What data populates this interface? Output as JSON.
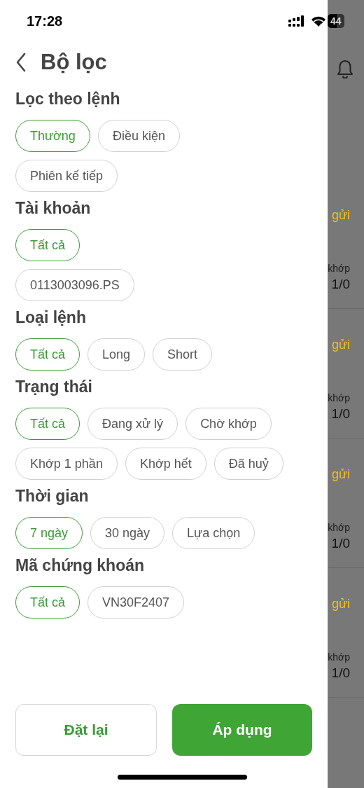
{
  "status_bar": {
    "time": "17:28",
    "battery": "44"
  },
  "header": {
    "title": "Bộ lọc"
  },
  "sections": [
    {
      "title": "Lọc theo lệnh",
      "rows": [
        [
          {
            "label": "Thường",
            "selected": true
          },
          {
            "label": "Điều kiện",
            "selected": false
          }
        ],
        [
          {
            "label": "Phiên kế tiếp",
            "selected": false
          }
        ]
      ]
    },
    {
      "title": "Tài khoản",
      "rows": [
        [
          {
            "label": "Tất cả",
            "selected": true
          }
        ],
        [
          {
            "label": "0113003096.PS",
            "selected": false
          }
        ]
      ]
    },
    {
      "title": "Loại lệnh",
      "rows": [
        [
          {
            "label": "Tất cả",
            "selected": true
          },
          {
            "label": "Long",
            "selected": false
          },
          {
            "label": "Short",
            "selected": false
          }
        ]
      ]
    },
    {
      "title": "Trạng thái",
      "rows": [
        [
          {
            "label": "Tất cả",
            "selected": true
          },
          {
            "label": "Đang xử lý",
            "selected": false
          },
          {
            "label": "Chờ khớp",
            "selected": false
          }
        ],
        [
          {
            "label": "Khớp 1 phần",
            "selected": false
          },
          {
            "label": "Khớp hết",
            "selected": false
          },
          {
            "label": "Đã huỷ",
            "selected": false
          }
        ]
      ]
    },
    {
      "title": "Thời gian",
      "rows": [
        [
          {
            "label": "7 ngày",
            "selected": true
          },
          {
            "label": "30 ngày",
            "selected": false
          },
          {
            "label": "Lựa chọn",
            "selected": false
          }
        ]
      ]
    },
    {
      "title": "Mã chứng khoán",
      "rows": [
        [
          {
            "label": "Tất cả",
            "selected": true
          },
          {
            "label": "VN30F2407",
            "selected": false
          }
        ]
      ]
    }
  ],
  "buttons": [
    {
      "label": "Đặt lại",
      "kind": "secondary"
    },
    {
      "label": "Áp dụng",
      "kind": "primary"
    }
  ],
  "background_items": [
    {
      "status": "gửi",
      "label": "khớp",
      "value": "1/0"
    },
    {
      "status": "gửi",
      "label": "khớp",
      "value": "1/0"
    },
    {
      "status": "gửi",
      "label": "khớp",
      "value": "1/0"
    },
    {
      "status": "gửi",
      "label": "khớp",
      "value": "1/0"
    }
  ]
}
